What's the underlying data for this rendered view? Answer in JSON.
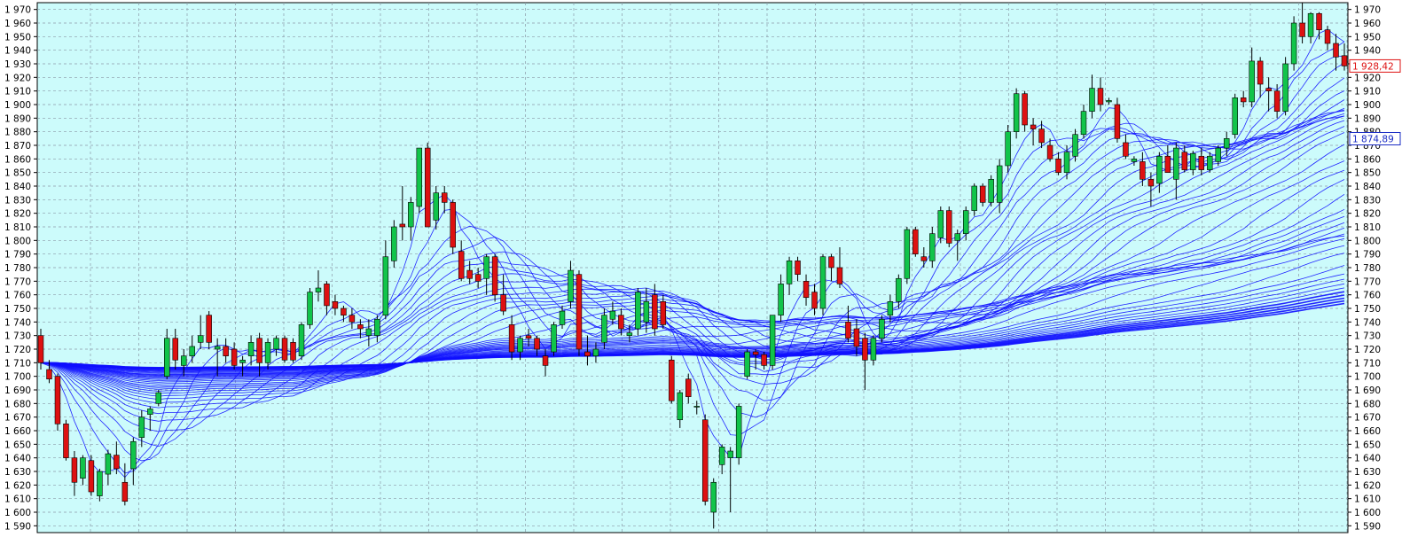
{
  "colors": {
    "background": "#ccfbfb",
    "grid": "#8a9aa8",
    "ma_lines": "#1010ff",
    "bull": "#11c44a",
    "bear": "#dd1111",
    "wick": "#000000",
    "price_tag_border": "#dd1111",
    "ma_tag_border": "#1a2cc4"
  },
  "chart_data": {
    "type": "candlestick",
    "ylim": [
      1585,
      1975
    ],
    "y_ticks": [
      1590,
      1600,
      1610,
      1620,
      1630,
      1640,
      1650,
      1660,
      1670,
      1680,
      1690,
      1700,
      1710,
      1720,
      1730,
      1740,
      1750,
      1760,
      1770,
      1780,
      1790,
      1800,
      1810,
      1820,
      1830,
      1840,
      1850,
      1860,
      1870,
      1880,
      1890,
      1900,
      1910,
      1920,
      1930,
      1940,
      1950,
      1960,
      1970
    ],
    "y_tick_labels": [
      "1 590",
      "1 600",
      "1 610",
      "1 620",
      "1 630",
      "1 640",
      "1 650",
      "1 660",
      "1 670",
      "1 680",
      "1 690",
      "1 700",
      "1 710",
      "1 720",
      "1 730",
      "1 740",
      "1 750",
      "1 760",
      "1 770",
      "1 780",
      "1 790",
      "1 800",
      "1 810",
      "1 820",
      "1 830",
      "1 840",
      "1 850",
      "1 860",
      "1 870",
      "1 880",
      "1 890",
      "1 900",
      "1 910",
      "1 920",
      "1 930",
      "1 940",
      "1 950",
      "1 960",
      "1 970"
    ],
    "candles": [
      {
        "o": 1730,
        "h": 1735,
        "l": 1705,
        "c": 1710
      },
      {
        "o": 1705,
        "h": 1712,
        "l": 1695,
        "c": 1698
      },
      {
        "o": 1700,
        "h": 1702,
        "l": 1660,
        "c": 1665
      },
      {
        "o": 1665,
        "h": 1668,
        "l": 1638,
        "c": 1640
      },
      {
        "o": 1640,
        "h": 1645,
        "l": 1612,
        "c": 1622
      },
      {
        "o": 1625,
        "h": 1642,
        "l": 1620,
        "c": 1640
      },
      {
        "o": 1638,
        "h": 1642,
        "l": 1612,
        "c": 1615
      },
      {
        "o": 1612,
        "h": 1632,
        "l": 1608,
        "c": 1630
      },
      {
        "o": 1628,
        "h": 1646,
        "l": 1620,
        "c": 1643
      },
      {
        "o": 1642,
        "h": 1652,
        "l": 1628,
        "c": 1632
      },
      {
        "o": 1622,
        "h": 1636,
        "l": 1605,
        "c": 1608
      },
      {
        "o": 1632,
        "h": 1655,
        "l": 1620,
        "c": 1652
      },
      {
        "o": 1655,
        "h": 1675,
        "l": 1648,
        "c": 1670
      },
      {
        "o": 1672,
        "h": 1678,
        "l": 1660,
        "c": 1676
      },
      {
        "o": 1680,
        "h": 1690,
        "l": 1678,
        "c": 1688
      },
      {
        "o": 1700,
        "h": 1735,
        "l": 1698,
        "c": 1728
      },
      {
        "o": 1728,
        "h": 1735,
        "l": 1705,
        "c": 1712
      },
      {
        "o": 1708,
        "h": 1720,
        "l": 1700,
        "c": 1715
      },
      {
        "o": 1715,
        "h": 1730,
        "l": 1710,
        "c": 1722
      },
      {
        "o": 1725,
        "h": 1745,
        "l": 1720,
        "c": 1730
      },
      {
        "o": 1745,
        "h": 1748,
        "l": 1720,
        "c": 1725
      },
      {
        "o": 1720,
        "h": 1728,
        "l": 1700,
        "c": 1722
      },
      {
        "o": 1722,
        "h": 1728,
        "l": 1710,
        "c": 1715
      },
      {
        "o": 1720,
        "h": 1725,
        "l": 1705,
        "c": 1708
      },
      {
        "o": 1710,
        "h": 1715,
        "l": 1700,
        "c": 1712
      },
      {
        "o": 1715,
        "h": 1730,
        "l": 1708,
        "c": 1725
      },
      {
        "o": 1728,
        "h": 1732,
        "l": 1700,
        "c": 1710
      },
      {
        "o": 1710,
        "h": 1728,
        "l": 1705,
        "c": 1725
      },
      {
        "o": 1720,
        "h": 1730,
        "l": 1715,
        "c": 1728
      },
      {
        "o": 1728,
        "h": 1730,
        "l": 1710,
        "c": 1712
      },
      {
        "o": 1725,
        "h": 1728,
        "l": 1710,
        "c": 1712
      },
      {
        "o": 1715,
        "h": 1740,
        "l": 1712,
        "c": 1738
      },
      {
        "o": 1738,
        "h": 1765,
        "l": 1735,
        "c": 1762
      },
      {
        "o": 1762,
        "h": 1778,
        "l": 1755,
        "c": 1765
      },
      {
        "o": 1768,
        "h": 1770,
        "l": 1745,
        "c": 1752
      },
      {
        "o": 1755,
        "h": 1760,
        "l": 1745,
        "c": 1750
      },
      {
        "o": 1750,
        "h": 1752,
        "l": 1740,
        "c": 1745
      },
      {
        "o": 1745,
        "h": 1750,
        "l": 1735,
        "c": 1740
      },
      {
        "o": 1738,
        "h": 1742,
        "l": 1728,
        "c": 1735
      },
      {
        "o": 1730,
        "h": 1742,
        "l": 1722,
        "c": 1735
      },
      {
        "o": 1730,
        "h": 1745,
        "l": 1725,
        "c": 1742
      },
      {
        "o": 1745,
        "h": 1800,
        "l": 1742,
        "c": 1788
      },
      {
        "o": 1785,
        "h": 1815,
        "l": 1780,
        "c": 1810
      },
      {
        "o": 1812,
        "h": 1840,
        "l": 1800,
        "c": 1810
      },
      {
        "o": 1810,
        "h": 1832,
        "l": 1800,
        "c": 1828
      },
      {
        "o": 1825,
        "h": 1868,
        "l": 1820,
        "c": 1868
      },
      {
        "o": 1868,
        "h": 1872,
        "l": 1810,
        "c": 1810
      },
      {
        "o": 1815,
        "h": 1840,
        "l": 1808,
        "c": 1835
      },
      {
        "o": 1835,
        "h": 1840,
        "l": 1820,
        "c": 1828
      },
      {
        "o": 1828,
        "h": 1830,
        "l": 1790,
        "c": 1795
      },
      {
        "o": 1792,
        "h": 1800,
        "l": 1770,
        "c": 1772
      },
      {
        "o": 1778,
        "h": 1785,
        "l": 1768,
        "c": 1772
      },
      {
        "o": 1775,
        "h": 1780,
        "l": 1765,
        "c": 1770
      },
      {
        "o": 1772,
        "h": 1790,
        "l": 1760,
        "c": 1788
      },
      {
        "o": 1788,
        "h": 1790,
        "l": 1755,
        "c": 1760
      },
      {
        "o": 1760,
        "h": 1775,
        "l": 1745,
        "c": 1748
      },
      {
        "o": 1738,
        "h": 1745,
        "l": 1712,
        "c": 1718
      },
      {
        "o": 1718,
        "h": 1730,
        "l": 1712,
        "c": 1728
      },
      {
        "o": 1730,
        "h": 1735,
        "l": 1722,
        "c": 1728
      },
      {
        "o": 1728,
        "h": 1730,
        "l": 1715,
        "c": 1720
      },
      {
        "o": 1715,
        "h": 1720,
        "l": 1700,
        "c": 1708
      },
      {
        "o": 1718,
        "h": 1740,
        "l": 1715,
        "c": 1738
      },
      {
        "o": 1738,
        "h": 1752,
        "l": 1735,
        "c": 1748
      },
      {
        "o": 1755,
        "h": 1785,
        "l": 1750,
        "c": 1778
      },
      {
        "o": 1775,
        "h": 1778,
        "l": 1715,
        "c": 1720
      },
      {
        "o": 1718,
        "h": 1730,
        "l": 1708,
        "c": 1715
      },
      {
        "o": 1715,
        "h": 1725,
        "l": 1710,
        "c": 1720
      },
      {
        "o": 1725,
        "h": 1750,
        "l": 1720,
        "c": 1745
      },
      {
        "o": 1742,
        "h": 1755,
        "l": 1738,
        "c": 1748
      },
      {
        "o": 1745,
        "h": 1750,
        "l": 1730,
        "c": 1735
      },
      {
        "o": 1730,
        "h": 1738,
        "l": 1725,
        "c": 1732
      },
      {
        "o": 1735,
        "h": 1765,
        "l": 1730,
        "c": 1762
      },
      {
        "o": 1740,
        "h": 1765,
        "l": 1732,
        "c": 1755
      },
      {
        "o": 1760,
        "h": 1768,
        "l": 1730,
        "c": 1735
      },
      {
        "o": 1755,
        "h": 1760,
        "l": 1735,
        "c": 1738
      },
      {
        "o": 1712,
        "h": 1715,
        "l": 1680,
        "c": 1682
      },
      {
        "o": 1668,
        "h": 1690,
        "l": 1662,
        "c": 1688
      },
      {
        "o": 1698,
        "h": 1702,
        "l": 1680,
        "c": 1685
      },
      {
        "o": 1678,
        "h": 1682,
        "l": 1672,
        "c": 1678
      },
      {
        "o": 1668,
        "h": 1672,
        "l": 1605,
        "c": 1608
      },
      {
        "o": 1600,
        "h": 1625,
        "l": 1588,
        "c": 1622
      },
      {
        "o": 1635,
        "h": 1650,
        "l": 1628,
        "c": 1648
      },
      {
        "o": 1640,
        "h": 1648,
        "l": 1600,
        "c": 1645
      },
      {
        "o": 1640,
        "h": 1680,
        "l": 1635,
        "c": 1678
      },
      {
        "o": 1700,
        "h": 1720,
        "l": 1698,
        "c": 1718
      },
      {
        "o": 1718,
        "h": 1720,
        "l": 1705,
        "c": 1716
      },
      {
        "o": 1716,
        "h": 1718,
        "l": 1705,
        "c": 1708
      },
      {
        "o": 1708,
        "h": 1745,
        "l": 1705,
        "c": 1745
      },
      {
        "o": 1745,
        "h": 1775,
        "l": 1740,
        "c": 1768
      },
      {
        "o": 1768,
        "h": 1788,
        "l": 1760,
        "c": 1785
      },
      {
        "o": 1785,
        "h": 1788,
        "l": 1770,
        "c": 1775
      },
      {
        "o": 1770,
        "h": 1775,
        "l": 1752,
        "c": 1758
      },
      {
        "o": 1762,
        "h": 1768,
        "l": 1745,
        "c": 1750
      },
      {
        "o": 1750,
        "h": 1790,
        "l": 1745,
        "c": 1788
      },
      {
        "o": 1788,
        "h": 1790,
        "l": 1770,
        "c": 1780
      },
      {
        "o": 1780,
        "h": 1795,
        "l": 1765,
        "c": 1768
      },
      {
        "o": 1740,
        "h": 1752,
        "l": 1725,
        "c": 1728
      },
      {
        "o": 1735,
        "h": 1742,
        "l": 1715,
        "c": 1722
      },
      {
        "o": 1728,
        "h": 1732,
        "l": 1690,
        "c": 1712
      },
      {
        "o": 1712,
        "h": 1730,
        "l": 1708,
        "c": 1728
      },
      {
        "o": 1728,
        "h": 1745,
        "l": 1725,
        "c": 1742
      },
      {
        "o": 1745,
        "h": 1760,
        "l": 1740,
        "c": 1755
      },
      {
        "o": 1755,
        "h": 1775,
        "l": 1750,
        "c": 1772
      },
      {
        "o": 1772,
        "h": 1810,
        "l": 1768,
        "c": 1808
      },
      {
        "o": 1808,
        "h": 1810,
        "l": 1788,
        "c": 1790
      },
      {
        "o": 1788,
        "h": 1795,
        "l": 1780,
        "c": 1785
      },
      {
        "o": 1785,
        "h": 1810,
        "l": 1780,
        "c": 1805
      },
      {
        "o": 1802,
        "h": 1825,
        "l": 1798,
        "c": 1822
      },
      {
        "o": 1822,
        "h": 1825,
        "l": 1795,
        "c": 1798
      },
      {
        "o": 1800,
        "h": 1808,
        "l": 1785,
        "c": 1805
      },
      {
        "o": 1805,
        "h": 1825,
        "l": 1800,
        "c": 1822
      },
      {
        "o": 1822,
        "h": 1842,
        "l": 1818,
        "c": 1840
      },
      {
        "o": 1840,
        "h": 1842,
        "l": 1825,
        "c": 1828
      },
      {
        "o": 1828,
        "h": 1848,
        "l": 1825,
        "c": 1845
      },
      {
        "o": 1828,
        "h": 1860,
        "l": 1820,
        "c": 1855
      },
      {
        "o": 1855,
        "h": 1885,
        "l": 1850,
        "c": 1880
      },
      {
        "o": 1880,
        "h": 1912,
        "l": 1875,
        "c": 1908
      },
      {
        "o": 1908,
        "h": 1910,
        "l": 1880,
        "c": 1885
      },
      {
        "o": 1885,
        "h": 1890,
        "l": 1870,
        "c": 1882
      },
      {
        "o": 1882,
        "h": 1888,
        "l": 1868,
        "c": 1872
      },
      {
        "o": 1870,
        "h": 1875,
        "l": 1858,
        "c": 1860
      },
      {
        "o": 1860,
        "h": 1865,
        "l": 1848,
        "c": 1850
      },
      {
        "o": 1850,
        "h": 1870,
        "l": 1845,
        "c": 1865
      },
      {
        "o": 1862,
        "h": 1882,
        "l": 1858,
        "c": 1878
      },
      {
        "o": 1878,
        "h": 1900,
        "l": 1875,
        "c": 1895
      },
      {
        "o": 1895,
        "h": 1922,
        "l": 1890,
        "c": 1912
      },
      {
        "o": 1912,
        "h": 1920,
        "l": 1895,
        "c": 1900
      },
      {
        "o": 1902,
        "h": 1905,
        "l": 1900,
        "c": 1903
      },
      {
        "o": 1900,
        "h": 1905,
        "l": 1872,
        "c": 1875
      },
      {
        "o": 1872,
        "h": 1878,
        "l": 1860,
        "c": 1862
      },
      {
        "o": 1858,
        "h": 1862,
        "l": 1855,
        "c": 1860
      },
      {
        "o": 1858,
        "h": 1865,
        "l": 1840,
        "c": 1845
      },
      {
        "o": 1845,
        "h": 1850,
        "l": 1825,
        "c": 1840
      },
      {
        "o": 1842,
        "h": 1865,
        "l": 1835,
        "c": 1862
      },
      {
        "o": 1862,
        "h": 1870,
        "l": 1850,
        "c": 1850
      },
      {
        "o": 1845,
        "h": 1872,
        "l": 1830,
        "c": 1868
      },
      {
        "o": 1865,
        "h": 1870,
        "l": 1850,
        "c": 1852
      },
      {
        "o": 1852,
        "h": 1866,
        "l": 1848,
        "c": 1864
      },
      {
        "o": 1862,
        "h": 1868,
        "l": 1848,
        "c": 1852
      },
      {
        "o": 1852,
        "h": 1865,
        "l": 1850,
        "c": 1862
      },
      {
        "o": 1858,
        "h": 1870,
        "l": 1855,
        "c": 1868
      },
      {
        "o": 1868,
        "h": 1880,
        "l": 1862,
        "c": 1875
      },
      {
        "o": 1878,
        "h": 1908,
        "l": 1875,
        "c": 1905
      },
      {
        "o": 1905,
        "h": 1910,
        "l": 1898,
        "c": 1902
      },
      {
        "o": 1902,
        "h": 1942,
        "l": 1898,
        "c": 1932
      },
      {
        "o": 1932,
        "h": 1935,
        "l": 1905,
        "c": 1915
      },
      {
        "o": 1912,
        "h": 1920,
        "l": 1895,
        "c": 1910
      },
      {
        "o": 1910,
        "h": 1915,
        "l": 1890,
        "c": 1895
      },
      {
        "o": 1895,
        "h": 1935,
        "l": 1892,
        "c": 1930
      },
      {
        "o": 1930,
        "h": 1965,
        "l": 1925,
        "c": 1960
      },
      {
        "o": 1960,
        "h": 1975,
        "l": 1945,
        "c": 1950
      },
      {
        "o": 1950,
        "h": 1968,
        "l": 1945,
        "c": 1967
      },
      {
        "o": 1967,
        "h": 1968,
        "l": 1948,
        "c": 1955
      },
      {
        "o": 1955,
        "h": 1958,
        "l": 1940,
        "c": 1945
      },
      {
        "o": 1945,
        "h": 1952,
        "l": 1925,
        "c": 1935
      },
      {
        "o": 1936,
        "h": 1945,
        "l": 1925,
        "c": 1928.42
      }
    ],
    "moving_average_periods": [
      5,
      8,
      11,
      14,
      17,
      20,
      23,
      26,
      29,
      32,
      35,
      38,
      41,
      44,
      47,
      50,
      55,
      60,
      65,
      70,
      75,
      80,
      85,
      90,
      95,
      100,
      110,
      120,
      130,
      140,
      150,
      160,
      170,
      180,
      190,
      200,
      210,
      220,
      230,
      240
    ],
    "price_tag": {
      "label": "1 928,42",
      "value": 1928.42
    },
    "ma_tag": {
      "label": "1 874,89",
      "value": 1874.89
    }
  }
}
